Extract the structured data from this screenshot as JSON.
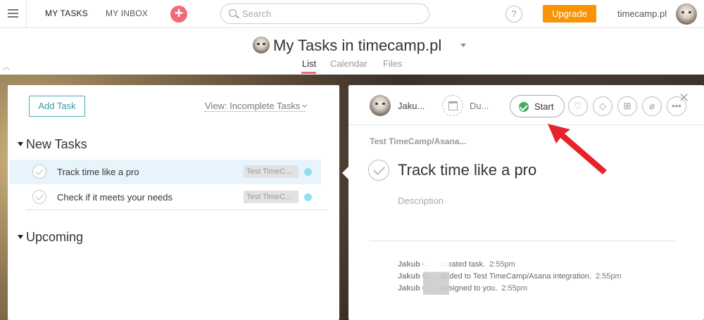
{
  "topbar": {
    "my_tasks": "MY TASKS",
    "my_inbox": "MY INBOX",
    "plus": "+",
    "search_placeholder": "Search",
    "help": "?",
    "upgrade": "Upgrade",
    "org": "timecamp.pl",
    "accent": "#f06a7a",
    "upgrade_color": "#f89406"
  },
  "project": {
    "title": "My Tasks in timecamp.pl",
    "tabs": [
      "List",
      "Calendar",
      "Files"
    ],
    "active_tab": "List"
  },
  "list": {
    "add_task": "Add Task",
    "view": "View: Incomplete Tasks",
    "sections": [
      {
        "name": "New Tasks",
        "tasks": [
          {
            "title": "Track time like a pro",
            "tag": "Test TimeC...",
            "selected": true
          },
          {
            "title": "Check if it meets your needs",
            "tag": "Test TimeC...",
            "selected": false
          }
        ]
      },
      {
        "name": "Upcoming",
        "tasks": []
      }
    ]
  },
  "detail": {
    "assignee": "Jaku...",
    "due": "Du...",
    "start": "Start",
    "close": "✕",
    "tools": [
      "♡",
      "⌂",
      "⎇",
      "⚲",
      "•••"
    ],
    "breadcrumb": "Test TimeCamp/Asana...",
    "title": "Track time like a pro",
    "description_placeholder": "Description",
    "stories": [
      {
        "user": "Jakub C",
        "text": "created task.",
        "time": "2:55pm"
      },
      {
        "user": "Jakub C",
        "text": "added to Test TimeCamp/Asana integration.",
        "time": "2:55pm"
      },
      {
        "user": "Jakub C",
        "text": "assigned to you.",
        "time": "2:55pm"
      }
    ]
  }
}
